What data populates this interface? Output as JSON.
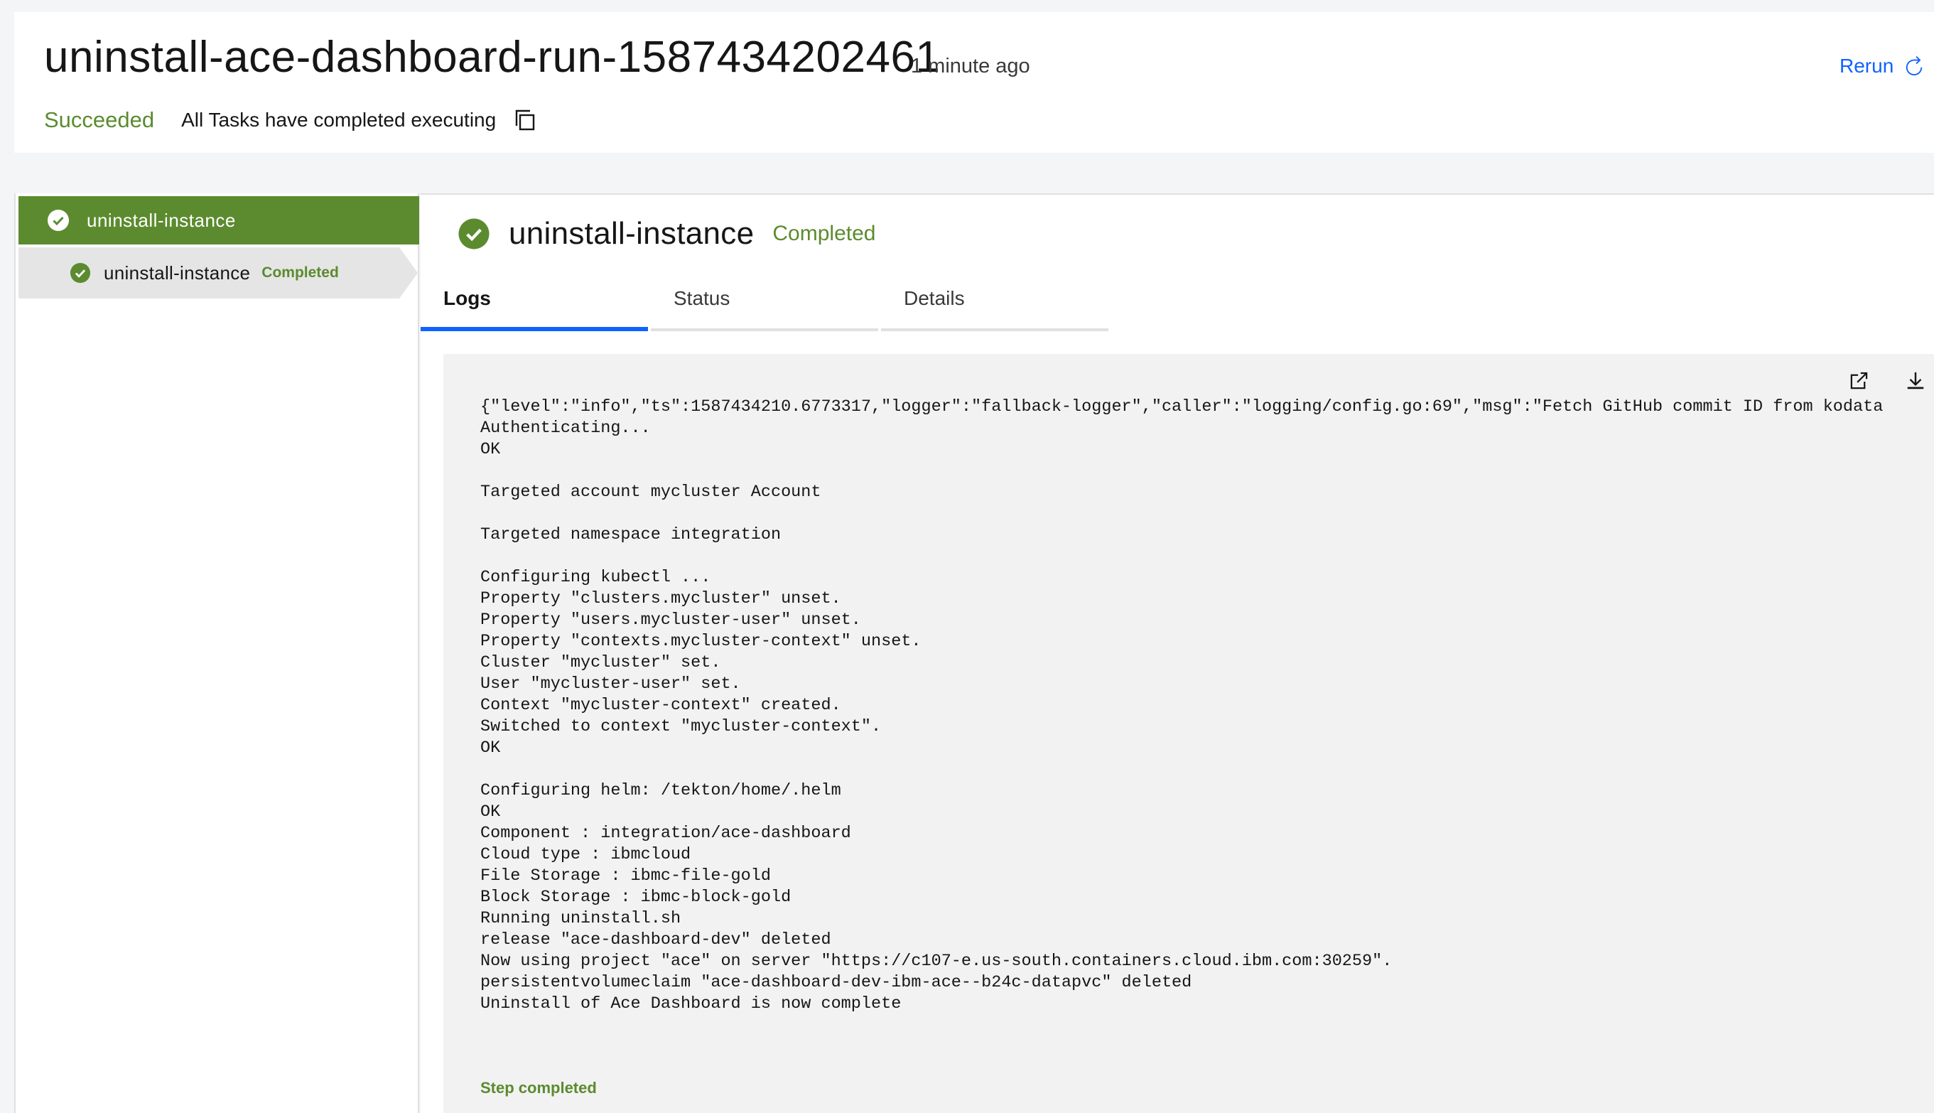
{
  "header": {
    "title": "uninstall-ace-dashboard-run-1587434202461",
    "time_ago": "1 minute ago",
    "rerun_label": "Rerun",
    "status": "Succeeded",
    "status_message": "All Tasks have completed executing"
  },
  "task_list": {
    "task": {
      "label": "uninstall-instance"
    },
    "step": {
      "label": "uninstall-instance",
      "status": "Completed"
    }
  },
  "step_details": {
    "name": "uninstall-instance",
    "status": "Completed",
    "tabs": [
      {
        "label": "Logs",
        "active": true
      },
      {
        "label": "Status",
        "active": false
      },
      {
        "label": "Details",
        "active": false
      }
    ]
  },
  "logs": {
    "lines": [
      "{\"level\":\"info\",\"ts\":1587434210.6773317,\"logger\":\"fallback-logger\",\"caller\":\"logging/config.go:69\",\"msg\":\"Fetch GitHub commit ID from kodata failed\"",
      "Authenticating...",
      "OK",
      "",
      "Targeted account mycluster Account",
      "",
      "Targeted namespace integration",
      "",
      "Configuring kubectl ...",
      "Property \"clusters.mycluster\" unset.",
      "Property \"users.mycluster-user\" unset.",
      "Property \"contexts.mycluster-context\" unset.",
      "Cluster \"mycluster\" set.",
      "User \"mycluster-user\" set.",
      "Context \"mycluster-context\" created.",
      "Switched to context \"mycluster-context\".",
      "OK",
      "",
      "Configuring helm: /tekton/home/.helm",
      "OK",
      "Component : integration/ace-dashboard",
      "Cloud type : ibmcloud",
      "File Storage : ibmc-file-gold",
      "Block Storage : ibmc-block-gold",
      "Running uninstall.sh",
      "release \"ace-dashboard-dev\" deleted",
      "Now using project \"ace\" on server \"https://c107-e.us-south.containers.cloud.ibm.com:30259\".",
      "persistentvolumeclaim \"ace-dashboard-dev-ibm-ace--b24c-datapvc\" deleted",
      "Uninstall of Ace Dashboard is now complete"
    ],
    "footer": "Step completed"
  },
  "colors": {
    "success": "#5b8b2e",
    "link": "#0f62fe",
    "log_background": "#f2f2f3"
  },
  "icons": {
    "rerun": "refresh-icon",
    "copy": "copy-icon",
    "status": "checkmark-filled-icon",
    "open_external": "launch-icon",
    "download": "download-icon"
  }
}
